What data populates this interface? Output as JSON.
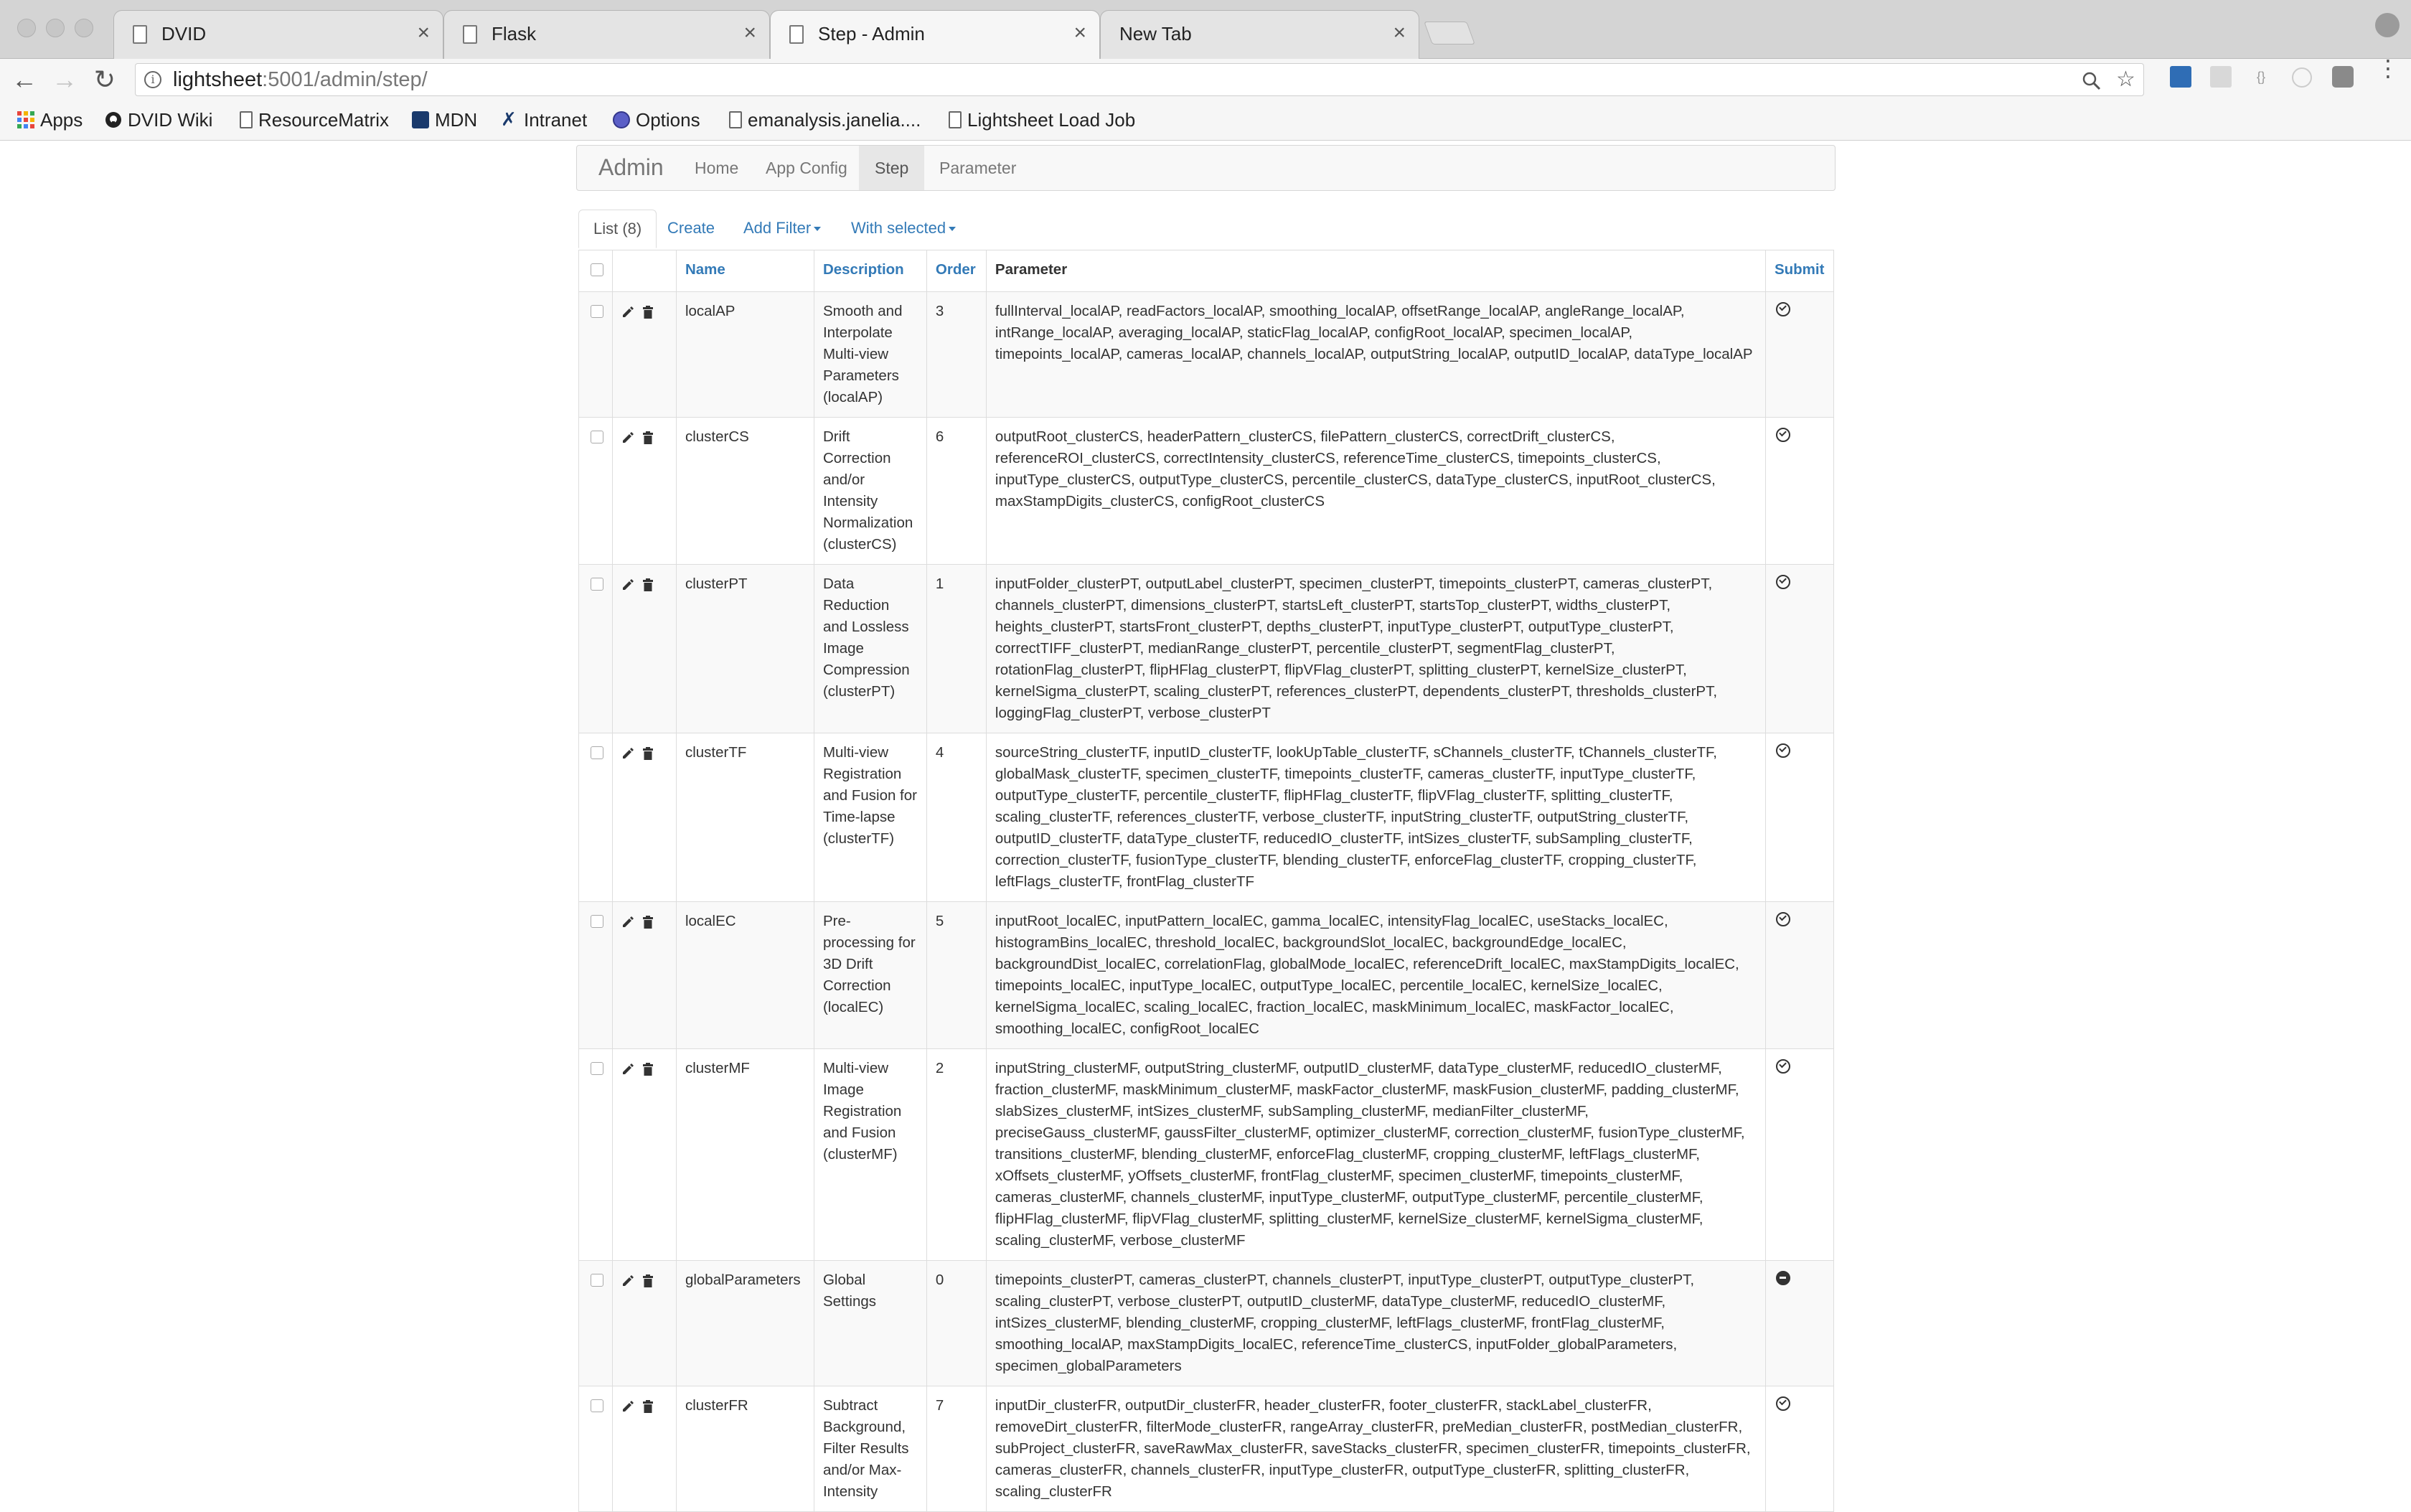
{
  "browser": {
    "tabs": [
      {
        "title": "DVID",
        "active": false
      },
      {
        "title": "Flask",
        "active": false
      },
      {
        "title": "Step - Admin",
        "active": true
      },
      {
        "title": "New Tab",
        "active": false
      }
    ],
    "close_glyph": "×",
    "url_host": "lightsheet",
    "url_rest": ":5001/admin/step/",
    "bookmarks": [
      "Apps",
      "DVID Wiki",
      "ResourceMatrix",
      "MDN",
      "Intranet",
      "Options",
      "emanalysis.janelia....",
      "Lightsheet Load Job"
    ]
  },
  "navbar": {
    "brand": "Admin",
    "links": [
      "Home",
      "App Config",
      "Step",
      "Parameter"
    ],
    "active": "Step"
  },
  "subtabs": {
    "list": "List (8)",
    "create": "Create",
    "add_filter": "Add Filter",
    "with_selected": "With selected"
  },
  "table": {
    "headers": {
      "name": "Name",
      "description": "Description",
      "order": "Order",
      "parameter": "Parameter",
      "submit": "Submit"
    },
    "rows": [
      {
        "name": "localAP",
        "description": "Smooth and Interpolate Multi-view Parameters (localAP)",
        "order": "3",
        "parameter": "fullInterval_localAP, readFactors_localAP, smoothing_localAP, offsetRange_localAP, angleRange_localAP, intRange_localAP, averaging_localAP, staticFlag_localAP, configRoot_localAP, specimen_localAP, timepoints_localAP, cameras_localAP, channels_localAP, outputString_localAP, outputID_localAP, dataType_localAP",
        "submit": "check"
      },
      {
        "name": "clusterCS",
        "description": "Drift Correction and/or Intensity Normalization (clusterCS)",
        "order": "6",
        "parameter": "outputRoot_clusterCS, headerPattern_clusterCS, filePattern_clusterCS, correctDrift_clusterCS, referenceROI_clusterCS, correctIntensity_clusterCS, referenceTime_clusterCS, timepoints_clusterCS, inputType_clusterCS, outputType_clusterCS, percentile_clusterCS, dataType_clusterCS, inputRoot_clusterCS, maxStampDigits_clusterCS, configRoot_clusterCS",
        "submit": "check"
      },
      {
        "name": "clusterPT",
        "description": "Data Reduction and Lossless Image Compression (clusterPT)",
        "order": "1",
        "parameter": "inputFolder_clusterPT, outputLabel_clusterPT, specimen_clusterPT, timepoints_clusterPT, cameras_clusterPT, channels_clusterPT, dimensions_clusterPT, startsLeft_clusterPT, startsTop_clusterPT, widths_clusterPT, heights_clusterPT, startsFront_clusterPT, depths_clusterPT, inputType_clusterPT, outputType_clusterPT, correctTIFF_clusterPT, medianRange_clusterPT, percentile_clusterPT, segmentFlag_clusterPT, rotationFlag_clusterPT, flipHFlag_clusterPT, flipVFlag_clusterPT, splitting_clusterPT, kernelSize_clusterPT, kernelSigma_clusterPT, scaling_clusterPT, references_clusterPT, dependents_clusterPT, thresholds_clusterPT, loggingFlag_clusterPT, verbose_clusterPT",
        "submit": "check"
      },
      {
        "name": "clusterTF",
        "description": "Multi-view Registration and Fusion for Time-lapse (clusterTF)",
        "order": "4",
        "parameter": "sourceString_clusterTF, inputID_clusterTF, lookUpTable_clusterTF, sChannels_clusterTF, tChannels_clusterTF, globalMask_clusterTF, specimen_clusterTF, timepoints_clusterTF, cameras_clusterTF, inputType_clusterTF, outputType_clusterTF, percentile_clusterTF, flipHFlag_clusterTF, flipVFlag_clusterTF, splitting_clusterTF, scaling_clusterTF, references_clusterTF, verbose_clusterTF, inputString_clusterTF, outputString_clusterTF, outputID_clusterTF, dataType_clusterTF, reducedIO_clusterTF, intSizes_clusterTF, subSampling_clusterTF, correction_clusterTF, fusionType_clusterTF, blending_clusterTF, enforceFlag_clusterTF, cropping_clusterTF, leftFlags_clusterTF, frontFlag_clusterTF",
        "submit": "check"
      },
      {
        "name": "localEC",
        "description": "Pre-processing for 3D Drift Correction (localEC)",
        "order": "5",
        "parameter": "inputRoot_localEC, inputPattern_localEC, gamma_localEC, intensityFlag_localEC, useStacks_localEC, histogramBins_localEC, threshold_localEC, backgroundSlot_localEC, backgroundEdge_localEC, backgroundDist_localEC, correlationFlag, globalMode_localEC, referenceDrift_localEC, maxStampDigits_localEC, timepoints_localEC, inputType_localEC, outputType_localEC, percentile_localEC, kernelSize_localEC, kernelSigma_localEC, scaling_localEC, fraction_localEC, maskMinimum_localEC, maskFactor_localEC, smoothing_localEC, configRoot_localEC",
        "submit": "check"
      },
      {
        "name": "clusterMF",
        "description": "Multi-view Image Registration and Fusion (clusterMF)",
        "order": "2",
        "parameter": "inputString_clusterMF, outputString_clusterMF, outputID_clusterMF, dataType_clusterMF, reducedIO_clusterMF, fraction_clusterMF, maskMinimum_clusterMF, maskFactor_clusterMF, maskFusion_clusterMF, padding_clusterMF, slabSizes_clusterMF, intSizes_clusterMF, subSampling_clusterMF, medianFilter_clusterMF, preciseGauss_clusterMF, gaussFilter_clusterMF, optimizer_clusterMF, correction_clusterMF, fusionType_clusterMF, transitions_clusterMF, blending_clusterMF, enforceFlag_clusterMF, cropping_clusterMF, leftFlags_clusterMF, xOffsets_clusterMF, yOffsets_clusterMF, frontFlag_clusterMF, specimen_clusterMF, timepoints_clusterMF, cameras_clusterMF, channels_clusterMF, inputType_clusterMF, outputType_clusterMF, percentile_clusterMF, flipHFlag_clusterMF, flipVFlag_clusterMF, splitting_clusterMF, kernelSize_clusterMF, kernelSigma_clusterMF, scaling_clusterMF, verbose_clusterMF",
        "submit": "check"
      },
      {
        "name": "globalParameters",
        "description": "Global Settings",
        "order": "0",
        "parameter": "timepoints_clusterPT, cameras_clusterPT, channels_clusterPT, inputType_clusterPT, outputType_clusterPT, scaling_clusterPT, verbose_clusterPT, outputID_clusterMF, dataType_clusterMF, reducedIO_clusterMF, intSizes_clusterMF, blending_clusterMF, cropping_clusterMF, leftFlags_clusterMF, frontFlag_clusterMF, smoothing_localAP, maxStampDigits_localEC, referenceTime_clusterCS, inputFolder_globalParameters, specimen_globalParameters",
        "submit": "minus"
      },
      {
        "name": "clusterFR",
        "description": "Subtract Background, Filter Results and/or Max-Intensity",
        "order": "7",
        "parameter": "inputDir_clusterFR, outputDir_clusterFR, header_clusterFR, footer_clusterFR, stackLabel_clusterFR, removeDirt_clusterFR, filterMode_clusterFR, rangeArray_clusterFR, preMedian_clusterFR, postMedian_clusterFR, subProject_clusterFR, saveRawMax_clusterFR, saveStacks_clusterFR, specimen_clusterFR, timepoints_clusterFR, cameras_clusterFR, channels_clusterFR, inputType_clusterFR, outputType_clusterFR, splitting_clusterFR, scaling_clusterFR",
        "submit": "check"
      }
    ]
  },
  "colors": {
    "link": "#337ab7",
    "tab_bg": "#e4e4e4",
    "active_tab_bg": "#f6f6f6"
  }
}
